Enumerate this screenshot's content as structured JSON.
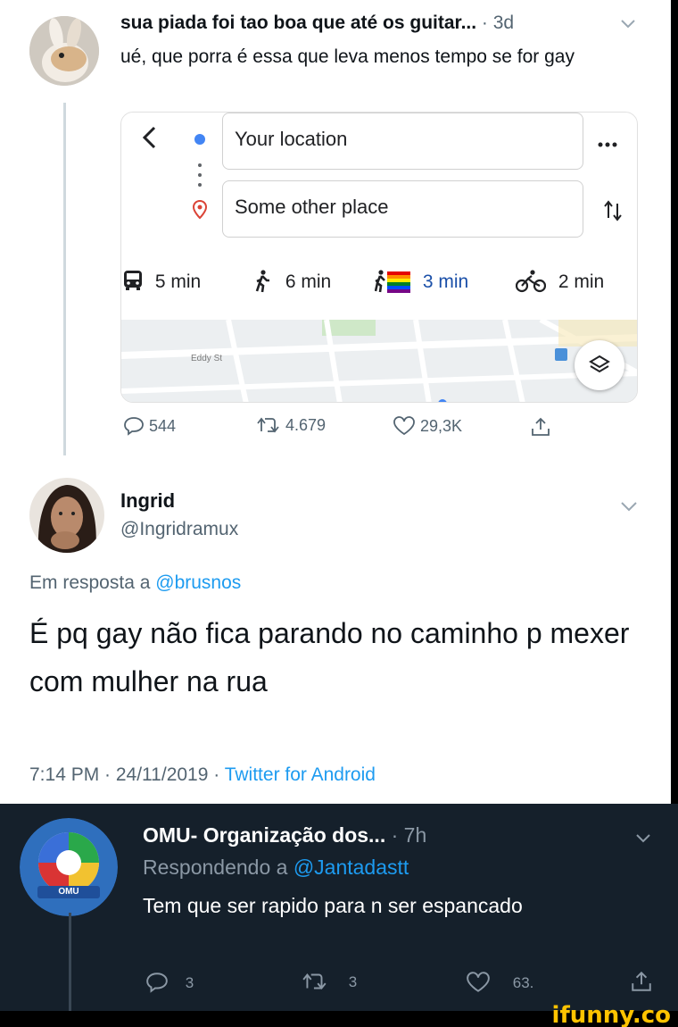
{
  "tweet1": {
    "author": "sua piada foi tao boa que até os guitar...",
    "time": "3d",
    "text": "ué, que porra é essa que leva menos tempo se for gay",
    "map": {
      "origin": "Your location",
      "destination": "Some other place",
      "modes": [
        {
          "icon": "bus-icon",
          "label": "5 min"
        },
        {
          "icon": "walk-icon",
          "label": "6 min"
        },
        {
          "icon": "walk-rainbow-icon",
          "label": "3 min"
        },
        {
          "icon": "bike-icon",
          "label": "2 min"
        }
      ],
      "street": "Eddy St"
    },
    "actions": {
      "replies": "544",
      "retweets": "4.679",
      "likes": "29,3K"
    }
  },
  "tweet2": {
    "name": "Ingrid",
    "handle": "@Ingridramux",
    "reply_prefix": "Em resposta a",
    "reply_to": "@brusnos",
    "text": "É pq gay não fica parando no caminho p mexer com mulher na rua",
    "timestamp": "7:14 PM · 24/11/2019 ·",
    "client": "Twitter for Android"
  },
  "tweet3": {
    "author": "OMU- Organização dos...",
    "time": "7h",
    "reply_prefix": "Respondendo a",
    "reply_to": "@Jantadastt",
    "text": "Tem que ser rapido para n ser espancado",
    "avatar_label": "OMU",
    "actions": {
      "replies": "3",
      "retweets": "3",
      "likes": "63."
    }
  },
  "watermark": "ifunny.co",
  "colors": {
    "link": "#1d9bf0",
    "dark_bg": "#15202b",
    "brand": "#ffc300"
  }
}
